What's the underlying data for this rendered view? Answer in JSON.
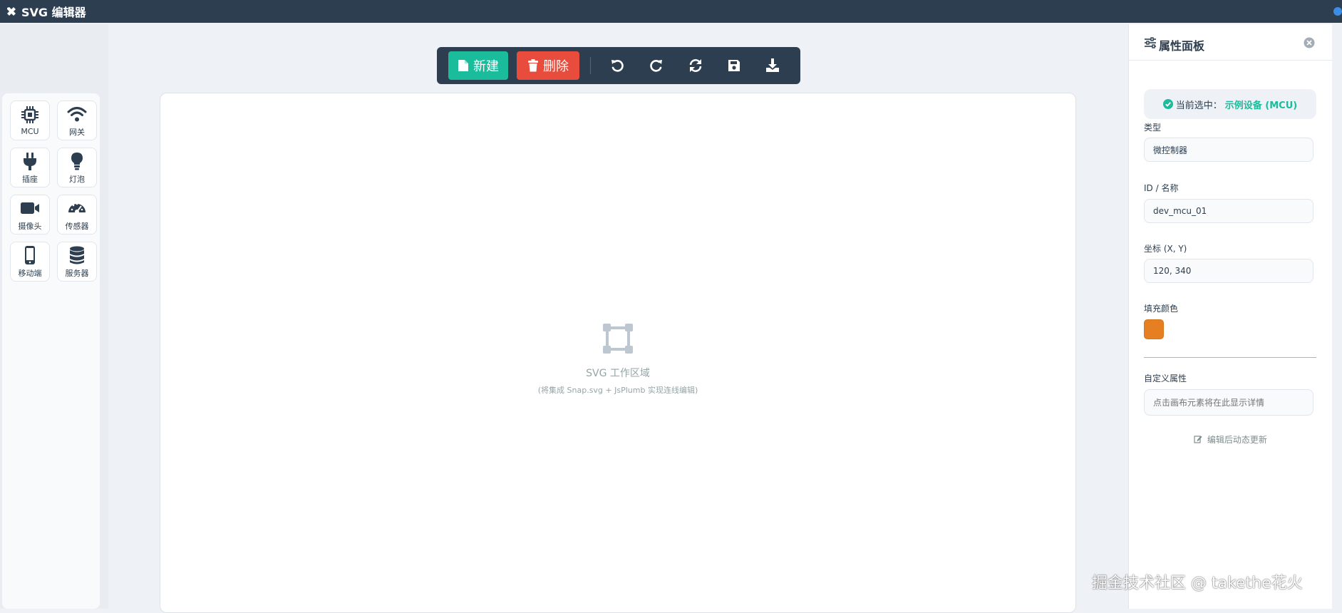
{
  "header": {
    "title": "SVG 编辑器"
  },
  "palette": {
    "items": [
      {
        "label": "MCU",
        "icon": "chip-icon"
      },
      {
        "label": "网关",
        "icon": "wifi-icon"
      },
      {
        "label": "插座",
        "icon": "plug-icon"
      },
      {
        "label": "灯泡",
        "icon": "lightbulb-icon"
      },
      {
        "label": "摄像头",
        "icon": "video-camera-icon"
      },
      {
        "label": "传感器",
        "icon": "gauge-icon"
      },
      {
        "label": "移动端",
        "icon": "mobile-icon"
      },
      {
        "label": "服务器",
        "icon": "database-icon"
      }
    ]
  },
  "toolbar": {
    "new_label": "新建",
    "delete_label": "删除",
    "icons": [
      "undo-icon",
      "redo-icon",
      "refresh-icon",
      "save-icon",
      "download-icon"
    ]
  },
  "canvas": {
    "title": "SVG 工作区域",
    "subtitle": "(将集成 Snap.svg + JsPlumb 实现连线编辑)"
  },
  "props": {
    "title": "属性面板",
    "selected_prefix": "当前选中：",
    "selected_value": "示例设备 (MCU)",
    "type_label": "类型",
    "type_value": "微控制器",
    "id_label": "ID / 名称",
    "id_value": "dev_mcu_01",
    "coord_label": "坐标 (X, Y)",
    "coord_value": "120, 340",
    "fill_label": "填充颜色",
    "fill_color": "#e67e22",
    "custom_label": "自定义属性",
    "custom_placeholder": "点击画布元素将在此显示详情",
    "edit_note": "编辑后动态更新"
  },
  "colors": {
    "header_bg": "#2c3e50",
    "accent": "#1abc9c",
    "danger": "#e74c3c"
  },
  "watermark": "掘金技术社区 @ takethe花火"
}
